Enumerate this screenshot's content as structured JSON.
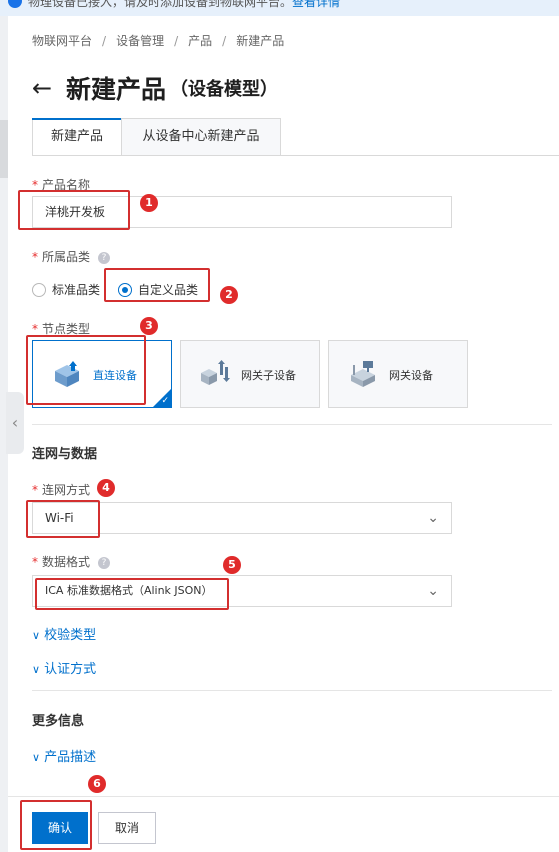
{
  "banner": {
    "text": "物理设备已接入，请及时添加设备到物联网平台。",
    "link": "查看详情"
  },
  "breadcrumb": [
    "物联网平台",
    "设备管理",
    "产品",
    "新建产品"
  ],
  "breadcrumb_sep": "/",
  "page": {
    "back": "←",
    "title": "新建产品",
    "subtitle": "（设备模型）"
  },
  "tabs": [
    {
      "label": "新建产品",
      "active": true
    },
    {
      "label": "从设备中心新建产品",
      "active": false
    }
  ],
  "form": {
    "required_mark": "*",
    "product_name": {
      "label": "产品名称",
      "value": "洋桃开发板"
    },
    "category": {
      "label": "所属品类",
      "options": [
        {
          "label": "标准品类",
          "checked": false
        },
        {
          "label": "自定义品类",
          "checked": true
        }
      ]
    },
    "node_type": {
      "label": "节点类型",
      "cards": [
        {
          "label": "直连设备",
          "selected": true,
          "icon": "direct-device-icon"
        },
        {
          "label": "网关子设备",
          "selected": false,
          "icon": "gateway-subdevice-icon"
        },
        {
          "label": "网关设备",
          "selected": false,
          "icon": "gateway-device-icon"
        }
      ],
      "check": "✓"
    },
    "network_section_title": "连网与数据",
    "network_method": {
      "label": "连网方式",
      "value": "Wi-Fi"
    },
    "data_format": {
      "label": "数据格式",
      "value": "ICA 标准数据格式（Alink JSON）"
    },
    "verify_type": "校验类型",
    "auth_method": "认证方式",
    "more_section_title": "更多信息",
    "product_desc": "产品描述",
    "help": "?",
    "chevron": "⌄",
    "expand": "∨"
  },
  "footer": {
    "confirm": "确认",
    "cancel": "取消"
  },
  "annotations": [
    "1",
    "2",
    "3",
    "4",
    "5",
    "6"
  ],
  "side_handle": "‹",
  "colors": {
    "accent": "#0070cc",
    "annotation": "#d32f2f",
    "required": "#e62e2e"
  }
}
